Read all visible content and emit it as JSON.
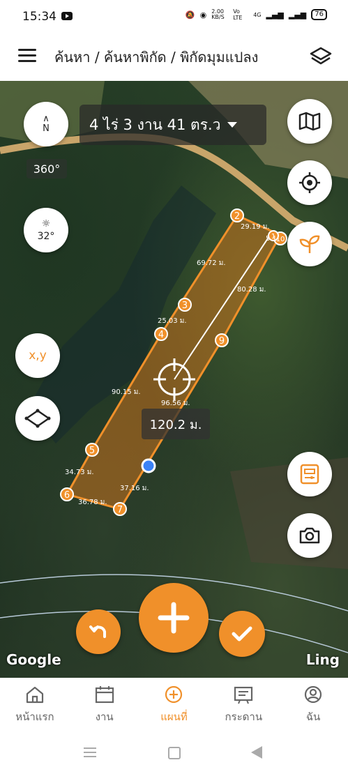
{
  "status": {
    "time": "15:34",
    "speed": "2.00\nKB/S",
    "network": "Vo LTE",
    "signal": "4G",
    "battery": "76"
  },
  "header": {
    "title": "ค้นหา / ค้นหาพิกัด / พิกัดมุมแปลง"
  },
  "map": {
    "area_label": "4 ไร่ 3 งาน 41 ตร.ว",
    "compass_label": "N",
    "rotation": "360°",
    "temperature": "32°",
    "coord_button": "x,y",
    "distance": "120.2 ม.",
    "google_logo": "Google",
    "ling_logo": "Ling",
    "points": [
      "2",
      "3",
      "4",
      "5",
      "6",
      "7",
      "9",
      "10",
      "1"
    ],
    "segments": [
      "29.19 ม.",
      "5.1",
      "69.72 ม.",
      "80.28 ม.",
      "25.03 ม.",
      "90.15 ม.",
      "96.56 ม.",
      "34.73 ม.",
      "37.16 ม.",
      "36.78 ม."
    ]
  },
  "nav": [
    {
      "label": "หน้าแรก"
    },
    {
      "label": "งาน"
    },
    {
      "label": "แผนที่"
    },
    {
      "label": "กระดาน"
    },
    {
      "label": "ฉัน"
    }
  ],
  "colors": {
    "accent": "#f0902a",
    "polygon": "#f0902a"
  }
}
